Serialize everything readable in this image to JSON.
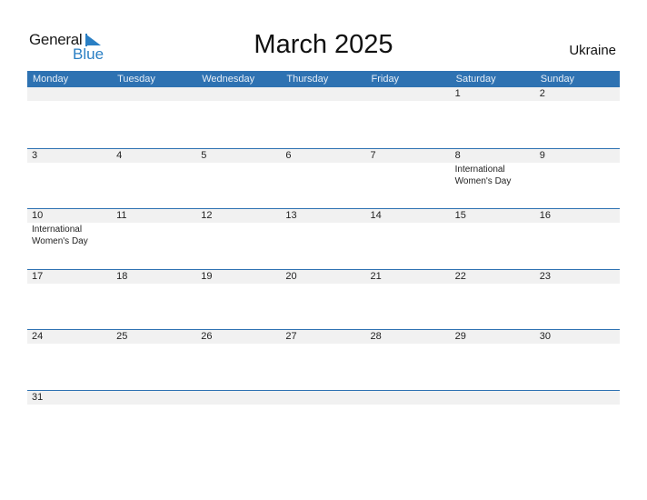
{
  "logo": {
    "general": "General",
    "blue": "Blue"
  },
  "title": "March 2025",
  "country": "Ukraine",
  "weekdays": [
    "Monday",
    "Tuesday",
    "Wednesday",
    "Thursday",
    "Friday",
    "Saturday",
    "Sunday"
  ],
  "weeks": [
    [
      {
        "day": ""
      },
      {
        "day": ""
      },
      {
        "day": ""
      },
      {
        "day": ""
      },
      {
        "day": ""
      },
      {
        "day": "1"
      },
      {
        "day": "2"
      }
    ],
    [
      {
        "day": "3"
      },
      {
        "day": "4"
      },
      {
        "day": "5"
      },
      {
        "day": "6"
      },
      {
        "day": "7"
      },
      {
        "day": "8",
        "event": "International Women's Day"
      },
      {
        "day": "9"
      }
    ],
    [
      {
        "day": "10",
        "event": "International Women's Day"
      },
      {
        "day": "11"
      },
      {
        "day": "12"
      },
      {
        "day": "13"
      },
      {
        "day": "14"
      },
      {
        "day": "15"
      },
      {
        "day": "16"
      }
    ],
    [
      {
        "day": "17"
      },
      {
        "day": "18"
      },
      {
        "day": "19"
      },
      {
        "day": "20"
      },
      {
        "day": "21"
      },
      {
        "day": "22"
      },
      {
        "day": "23"
      }
    ],
    [
      {
        "day": "24"
      },
      {
        "day": "25"
      },
      {
        "day": "26"
      },
      {
        "day": "27"
      },
      {
        "day": "28"
      },
      {
        "day": "29"
      },
      {
        "day": "30"
      }
    ],
    [
      {
        "day": "31"
      },
      {
        "day": ""
      },
      {
        "day": ""
      },
      {
        "day": ""
      },
      {
        "day": ""
      },
      {
        "day": ""
      },
      {
        "day": ""
      }
    ]
  ],
  "colors": {
    "header": "#2e72b2",
    "brand_blue": "#2a7fc4",
    "strip": "#f1f1f1"
  }
}
